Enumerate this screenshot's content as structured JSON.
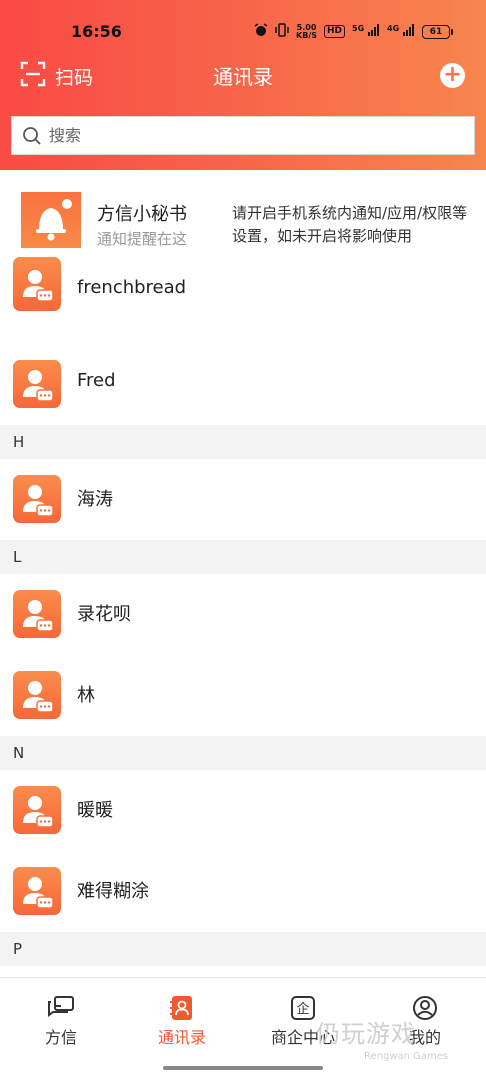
{
  "status": {
    "time": "16:56",
    "speed_top": "5.00",
    "speed_bottom": "KB/S",
    "hd": "HD",
    "net1": "5G",
    "net2": "4G",
    "battery": "61"
  },
  "header": {
    "scan_label": "扫码",
    "title": "通讯录",
    "add_icon": "plus-circle-icon"
  },
  "search": {
    "placeholder": "搜索"
  },
  "assistant": {
    "name": "方信小秘书",
    "subtitle": "通知提醒在这",
    "notice": "请开启手机系统内通知/应用/权限等设置，如未开启将影响使用"
  },
  "contacts": {
    "F": [
      "frenchbread",
      "Fred"
    ],
    "H_header": "H",
    "H": [
      "海涛"
    ],
    "L_header": "L",
    "L": [
      "录花呗",
      "林"
    ],
    "N_header": "N",
    "N": [
      "暖暖",
      "难得糊涂"
    ],
    "P_header": "P"
  },
  "tabs": [
    {
      "label": "方信",
      "icon": "chat-bubbles-icon",
      "active": false
    },
    {
      "label": "通讯录",
      "icon": "contacts-icon",
      "active": true
    },
    {
      "label": "商企中心",
      "icon": "enterprise-icon",
      "active": false
    },
    {
      "label": "我的",
      "icon": "profile-icon",
      "active": false
    }
  ],
  "watermark": {
    "main": "仍玩游戏",
    "sub": "Rengwan Games"
  },
  "colors": {
    "accent": "#f1592f",
    "header_start": "#f94a43",
    "header_end": "#f7864d"
  }
}
